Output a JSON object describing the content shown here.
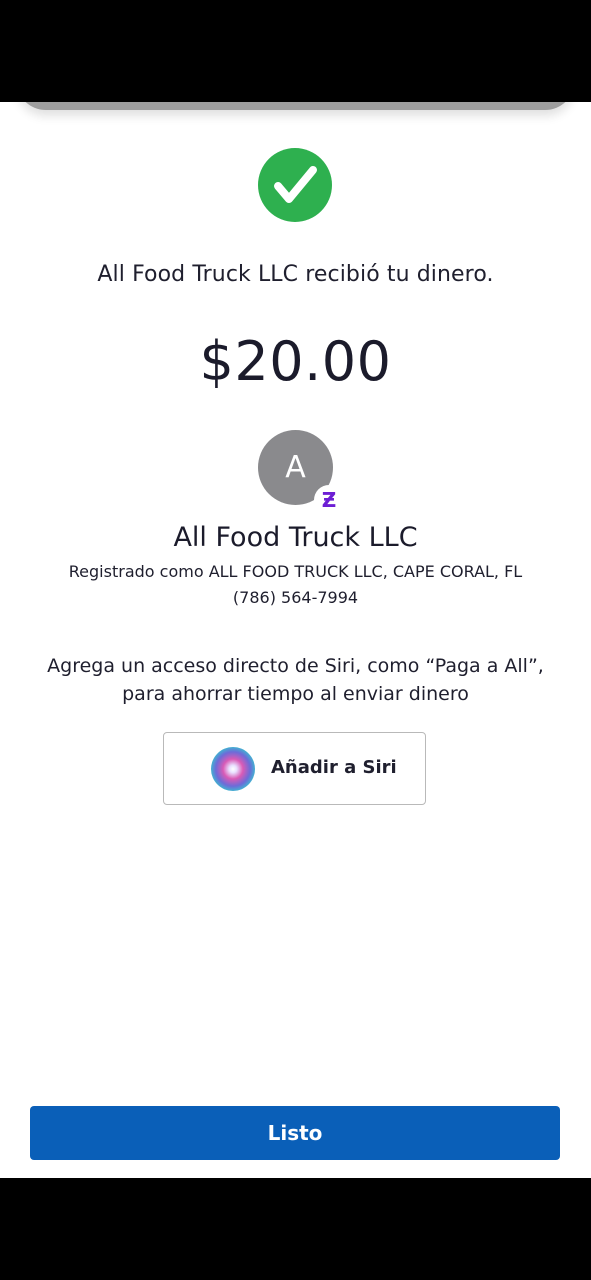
{
  "confirmation": {
    "message": "All Food Truck LLC recibió tu dinero.",
    "amount": "$20.00"
  },
  "recipient": {
    "avatar_letter": "A",
    "badge_symbol": "Ƶ",
    "name": "All Food Truck LLC",
    "registration": "Registrado como ALL FOOD TRUCK LLC, CAPE CORAL, FL",
    "phone": "(786) 564-7994"
  },
  "siri": {
    "hint_line1": "Agrega un acceso directo de Siri, como “Paga a All”,",
    "hint_line2": "para ahorrar tiempo al enviar dinero",
    "button_label": "Añadir a Siri",
    "icon": "siri-orb-icon"
  },
  "actions": {
    "done_label": "Listo"
  },
  "colors": {
    "success": "#2eb04f",
    "primary_button": "#0a5fb8",
    "zelle": "#6d1ed4",
    "avatar": "#8a8a8d"
  }
}
